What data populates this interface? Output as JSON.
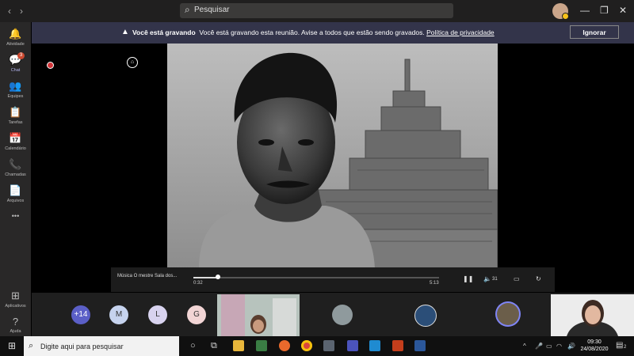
{
  "topbar": {
    "back": "‹",
    "forward": "›",
    "search_placeholder": "Pesquisar",
    "minimize": "—",
    "maximize": "❐",
    "close": "✕"
  },
  "rail": {
    "items": [
      {
        "label": "Atividade",
        "icon": "🔔"
      },
      {
        "label": "Chat",
        "icon": "💬",
        "badge": "3"
      },
      {
        "label": "Equipes",
        "icon": "👥"
      },
      {
        "label": "Tarefas",
        "icon": "📋"
      },
      {
        "label": "Calendário",
        "icon": "📅"
      },
      {
        "label": "Chamadas",
        "icon": "📞"
      },
      {
        "label": "Arquivos",
        "icon": "📄"
      }
    ],
    "more": "•••",
    "apps_label": "Aplicativos",
    "help_label": "Ajuda"
  },
  "banner": {
    "title": "Você está gravando",
    "message": "Você está gravando esta reunião. Avise a todos que estão sendo gravados.",
    "link": "Política de privacidade",
    "ignore": "Ignorar"
  },
  "player": {
    "title": "Música O mestre Sala dos...",
    "elapsed": "0:32",
    "duration": "5:13",
    "progress": 0.1,
    "volume": "31"
  },
  "participants": {
    "more_count": "+14",
    "initials": [
      "M",
      "L",
      "G"
    ]
  },
  "taskbar": {
    "search_placeholder": "Digite aqui para pesquisar",
    "time": "09:30",
    "date": "24/08/2020",
    "notifications": "2"
  }
}
